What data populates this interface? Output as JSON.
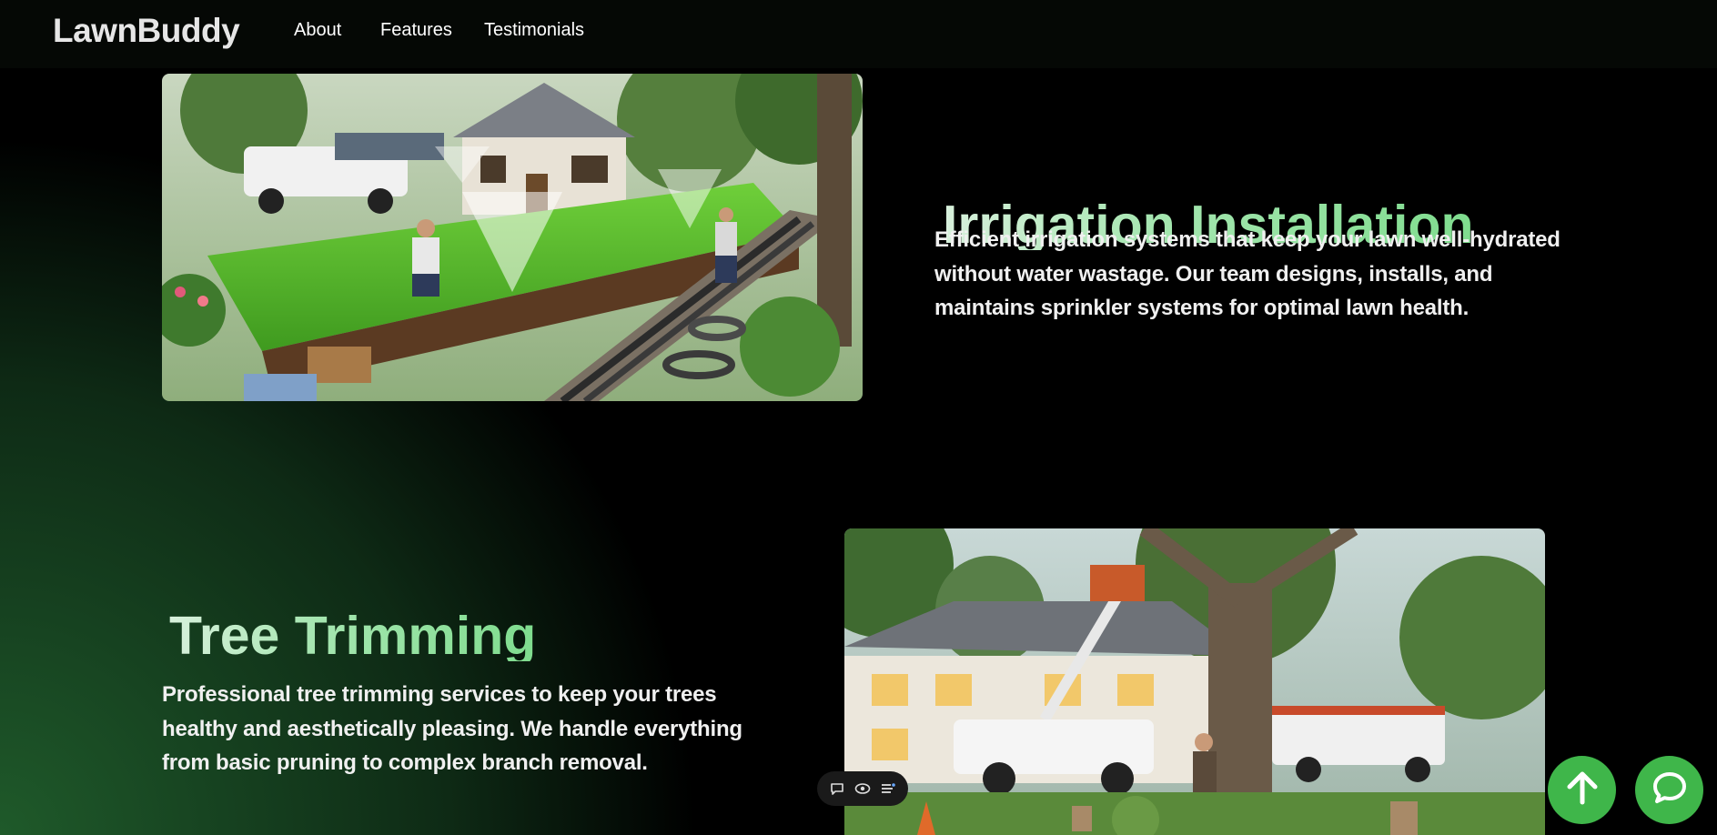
{
  "nav": {
    "brand": "LawnBuddy",
    "links": [
      "About",
      "Features",
      "Testimonials"
    ]
  },
  "sections": [
    {
      "title": "Irrigation Installation",
      "description": "Efficient irrigation systems that keep your lawn well-hydrated without water wastage. Our team designs, installs, and maintains sprinkler systems for optimal lawn health."
    },
    {
      "title": "Tree Trimming",
      "description": "Professional tree trimming services to keep your trees healthy and aesthetically pleasing. We handle everything from basic pruning to complex branch removal."
    }
  ],
  "icons": {
    "toolbar": [
      "comment-icon",
      "eye-icon",
      "list-icon"
    ],
    "scroll_top": "arrow-up-icon",
    "chat": "chat-bubble-icon"
  },
  "colors": {
    "accent_green": "#3fb64a",
    "title_gradient_start": "#d8f0dc",
    "title_gradient_end": "#7fdc8e",
    "nav_bg": "#050805"
  }
}
